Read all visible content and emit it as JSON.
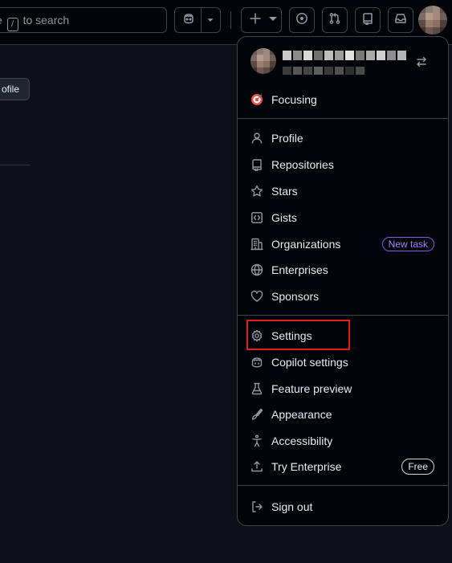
{
  "topbar": {
    "search_prefix": "e",
    "search_key": "/",
    "search_suffix": "to search"
  },
  "background": {
    "profile_chip": "ofile"
  },
  "menu": {
    "status": "Focusing",
    "items": [
      {
        "label": "Profile",
        "icon": "person-icon"
      },
      {
        "label": "Repositories",
        "icon": "repo-icon"
      },
      {
        "label": "Stars",
        "icon": "star-icon"
      },
      {
        "label": "Gists",
        "icon": "code-square-icon"
      },
      {
        "label": "Organizations",
        "icon": "organization-icon",
        "badge": "New task"
      },
      {
        "label": "Enterprises",
        "icon": "globe-icon"
      },
      {
        "label": "Sponsors",
        "icon": "heart-icon"
      },
      {
        "label": "Settings",
        "icon": "gear-icon"
      },
      {
        "label": "Copilot settings",
        "icon": "copilot-icon"
      },
      {
        "label": "Feature preview",
        "icon": "beaker-icon"
      },
      {
        "label": "Appearance",
        "icon": "paintbrush-icon"
      },
      {
        "label": "Accessibility",
        "icon": "accessibility-icon"
      },
      {
        "label": "Try Enterprise",
        "icon": "upload-icon",
        "badge": "Free"
      },
      {
        "label": "Sign out",
        "icon": "sign-out-icon"
      }
    ]
  },
  "colors": {
    "background": "#0d1117",
    "menu_background": "#010409",
    "highlight_box": "#e11d21",
    "badge_purple": "#8957e5"
  }
}
